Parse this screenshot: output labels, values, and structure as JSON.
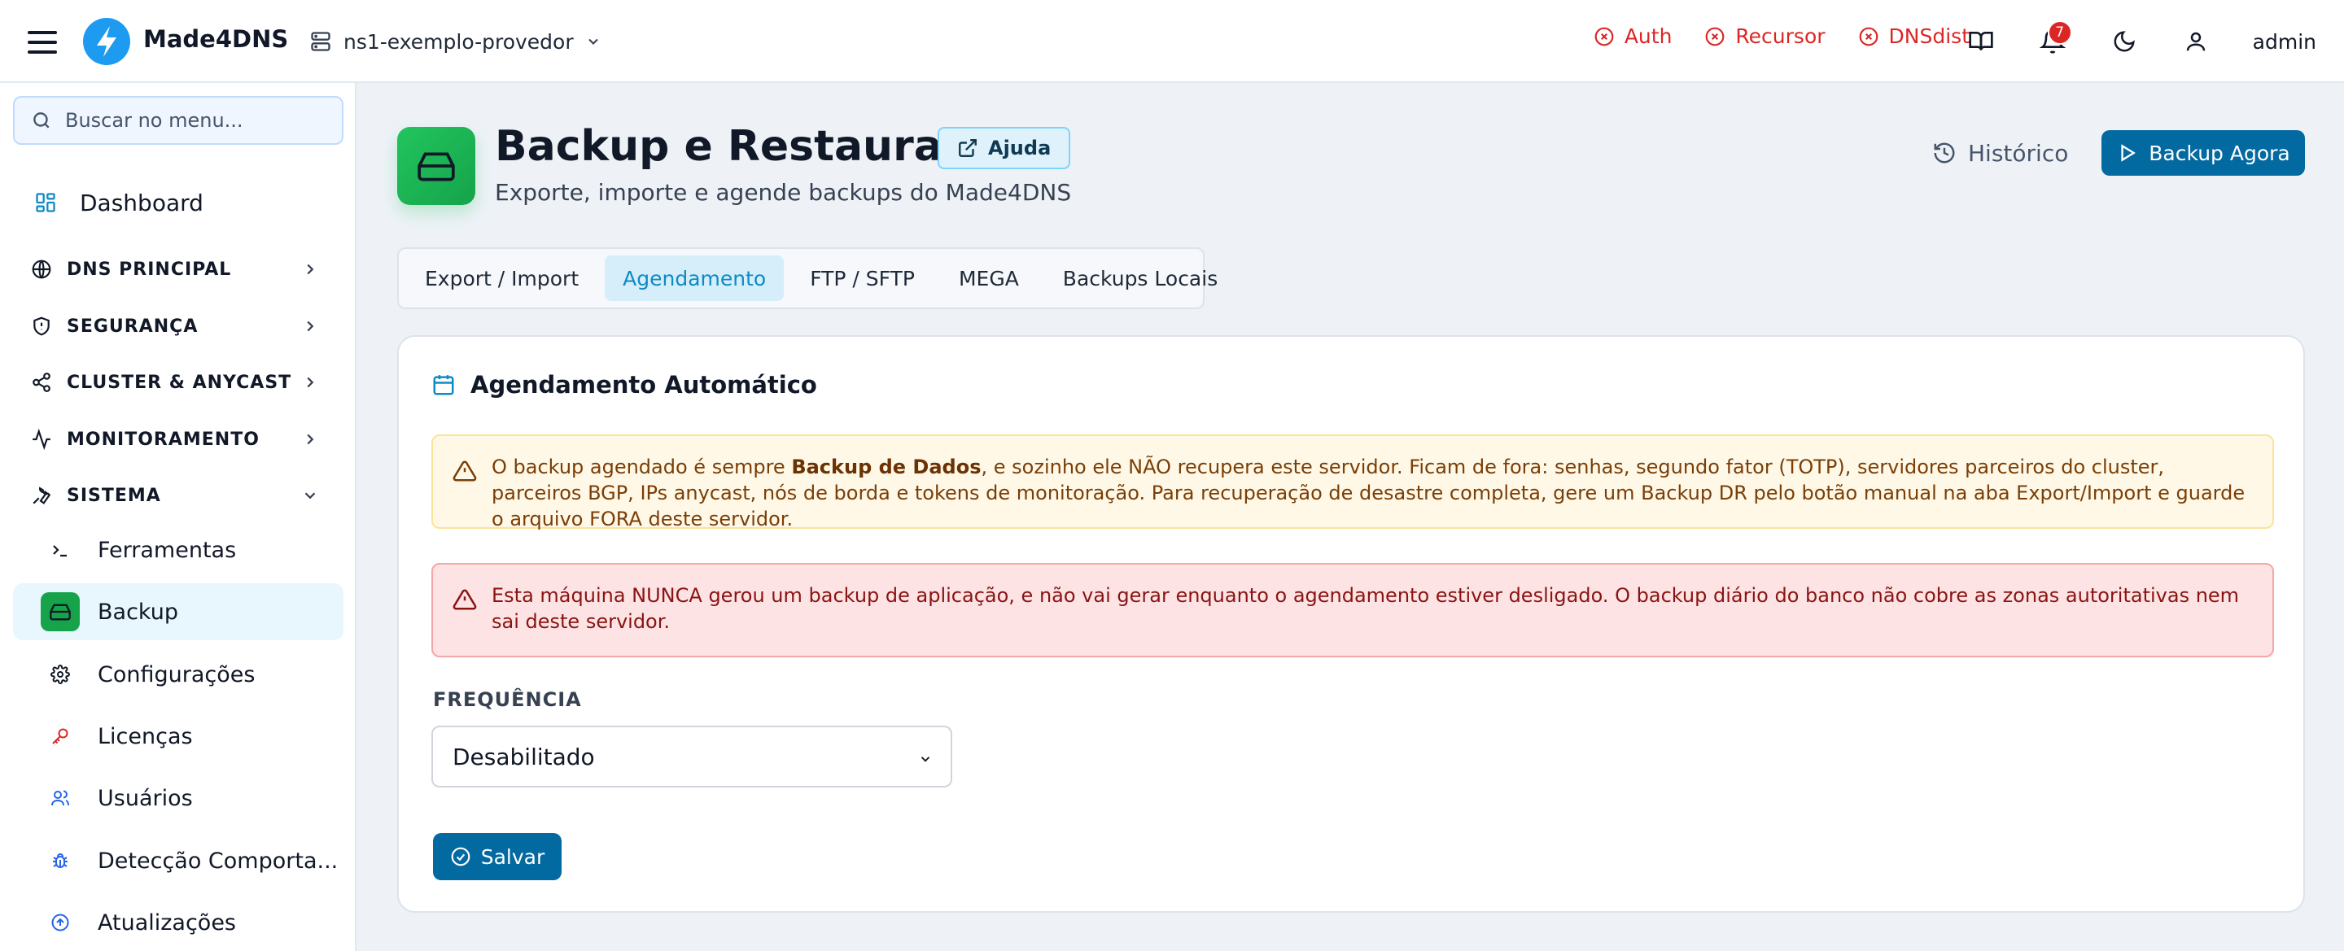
{
  "app": {
    "brand": "Made4DNS",
    "server": "ns1-exemplo-provedor",
    "user": "admin",
    "notifications_count": "7",
    "accent_color": "#0369a1"
  },
  "status_indicators": [
    {
      "label": "Auth",
      "state": "error"
    },
    {
      "label": "Recursor",
      "state": "error"
    },
    {
      "label": "DNSdist",
      "state": "error"
    }
  ],
  "top_icons": [
    "book-icon",
    "bell-icon",
    "moon-icon",
    "user-icon"
  ],
  "sidebar": {
    "search_placeholder": "Buscar no menu...",
    "dashboard": "Dashboard",
    "sections": [
      {
        "label": "DNS PRINCIPAL",
        "icon": "globe-icon",
        "expanded": false
      },
      {
        "label": "SEGURANÇA",
        "icon": "shield-icon",
        "expanded": false
      },
      {
        "label": "CLUSTER & ANYCAST",
        "icon": "share-icon",
        "expanded": false
      },
      {
        "label": "MONITORAMENTO",
        "icon": "activity-icon",
        "expanded": false
      },
      {
        "label": "SISTEMA",
        "icon": "wrench-icon",
        "expanded": true
      }
    ],
    "items": [
      {
        "label": "Ferramentas",
        "icon": "terminal-icon"
      },
      {
        "label": "Backup",
        "icon": "hard-drive-icon",
        "active": true
      },
      {
        "label": "Configurações",
        "icon": "gear-icon"
      },
      {
        "label": "Licenças",
        "icon": "key-icon"
      },
      {
        "label": "Usuários",
        "icon": "users-icon"
      },
      {
        "label": "Detecção Comporta...",
        "icon": "bug-icon"
      },
      {
        "label": "Atualizações",
        "icon": "arrow-up-circle-icon"
      }
    ]
  },
  "page": {
    "title": "Backup e Restauração",
    "help": "Ajuda",
    "subtitle": "Exporte, importe e agende backups do Made4DNS",
    "history": "Histórico",
    "backup_now": "Backup Agora"
  },
  "tabs": [
    {
      "label": "Export / Import",
      "active": false
    },
    {
      "label": "Agendamento",
      "active": true
    },
    {
      "label": "FTP / SFTP",
      "active": false
    },
    {
      "label": "MEGA",
      "active": false
    },
    {
      "label": "Backups Locais",
      "active": false
    }
  ],
  "schedule": {
    "title": "Agendamento Automático",
    "warning": {
      "prefix": "O backup agendado é sempre ",
      "bold": "Backup de Dados",
      "suffix": ", e sozinho ele NÃO recupera este servidor. Ficam de fora: senhas, segundo fator (TOTP), servidores parceiros do cluster, parceiros BGP, IPs anycast, nós de borda e tokens de monitoração. Para recuperação de desastre completa, gere um Backup DR pelo botão manual na aba Export/Import e guarde o arquivo FORA deste servidor."
    },
    "danger": "Esta máquina NUNCA gerou um backup de aplicação, e não vai gerar enquanto o agendamento estiver desligado. O backup diário do banco não cobre as zonas autoritativas nem sai deste servidor.",
    "frequency_label": "FREQUÊNCIA",
    "frequency_value": "Desabilitado",
    "save": "Salvar"
  }
}
